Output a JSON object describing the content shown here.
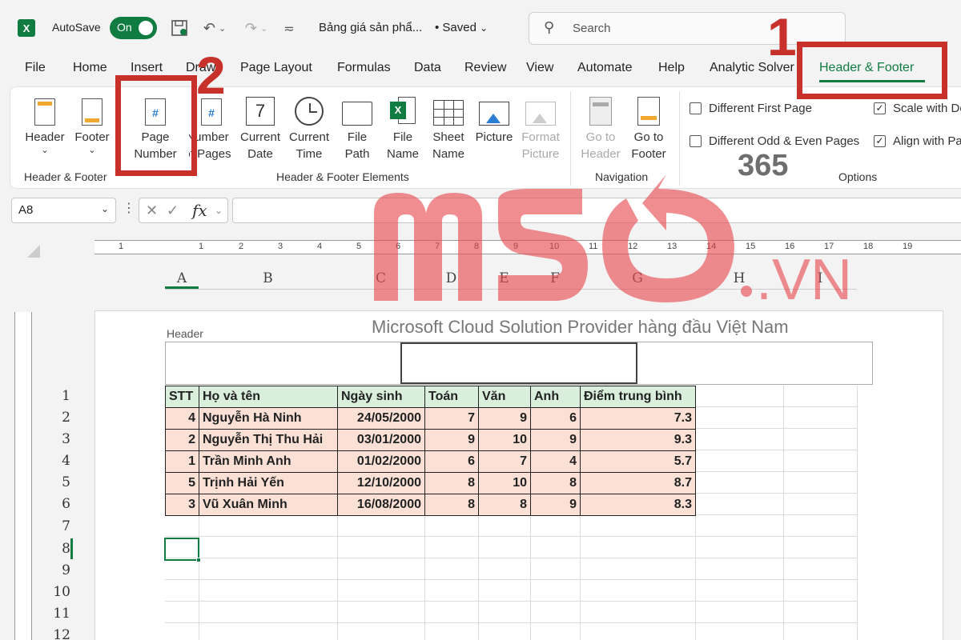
{
  "titlebar": {
    "autosave_label": "AutoSave",
    "autosave_state": "On",
    "doc_title": "Bảng giá sản phẩ...",
    "saved": "• Saved",
    "search_placeholder": "Search"
  },
  "tabs": [
    "File",
    "Home",
    "Insert",
    "Draw",
    "Page Layout",
    "Formulas",
    "Data",
    "Review",
    "View",
    "Automate",
    "Help",
    "Analytic Solver",
    "Header & Footer"
  ],
  "ribbon": {
    "header": "Header",
    "footer": "Footer",
    "page_number_1": "Page",
    "page_number_2": "Number",
    "num_pages_1": "Number",
    "num_pages_2": "of Pages",
    "current_date_1": "Current",
    "current_date_2": "Date",
    "current_time_1": "Current",
    "current_time_2": "Time",
    "file_path_1": "File",
    "file_path_2": "Path",
    "file_name_1": "File",
    "file_name_2": "Name",
    "sheet_name_1": "Sheet",
    "sheet_name_2": "Name",
    "picture": "Picture",
    "format_picture_1": "Format",
    "format_picture_2": "Picture",
    "go_header_1": "Go to",
    "go_header_2": "Header",
    "go_footer_1": "Go to",
    "go_footer_2": "Footer",
    "group_hf": "Header & Footer",
    "group_elements": "Header & Footer Elements",
    "group_nav": "Navigation",
    "group_options": "Options",
    "opt_diff_first": "Different First Page",
    "opt_diff_odd_even": "Different Odd & Even Pages",
    "opt_scale": "Scale with Do",
    "opt_align": "Align with Pa"
  },
  "formula_bar": {
    "name_box": "A8",
    "fx": "fx"
  },
  "columns": [
    "A",
    "B",
    "C",
    "D",
    "E",
    "F",
    "G",
    "H",
    "I"
  ],
  "ruler_numbers": [
    "1",
    "1",
    "2",
    "3",
    "4",
    "5",
    "6",
    "7",
    "8",
    "9",
    "10",
    "11",
    "12",
    "13",
    "14",
    "15",
    "16",
    "17",
    "18",
    "19"
  ],
  "page": {
    "header_label": "Header",
    "header_text": "Microsoft Cloud Solution Provider hàng đầu Việt Nam"
  },
  "rows": [
    "1",
    "2",
    "3",
    "4",
    "5",
    "6",
    "7",
    "8",
    "9",
    "10",
    "11",
    "12"
  ],
  "table": {
    "headers": [
      "STT",
      "Họ và tên",
      "Ngày sinh",
      "Toán",
      "Văn",
      "Anh",
      "Điểm trung bình"
    ],
    "data": [
      [
        "4",
        "Nguyễn Hà Ninh",
        "24/05/2000",
        "7",
        "9",
        "6",
        "7.3"
      ],
      [
        "2",
        "Nguyễn Thị Thu Hải",
        "03/01/2000",
        "9",
        "10",
        "9",
        "9.3"
      ],
      [
        "1",
        "Trần Minh Anh",
        "01/02/2000",
        "6",
        "7",
        "4",
        "5.7"
      ],
      [
        "5",
        "Trịnh Hải Yến",
        "12/10/2000",
        "8",
        "10",
        "8",
        "8.7"
      ],
      [
        "3",
        "Vũ Xuân Minh",
        "16/08/2000",
        "8",
        "8",
        "9",
        "8.3"
      ]
    ]
  },
  "annotations": {
    "step1": "1",
    "step2": "2"
  },
  "watermark": {
    "logo": "mso",
    "suffix": ".VN",
    "badge": "365"
  },
  "colors": {
    "excel_green": "#107c41",
    "annotation_red": "#c8302a",
    "header_row": "#d9eedb",
    "data_row": "#fbe0d6"
  }
}
